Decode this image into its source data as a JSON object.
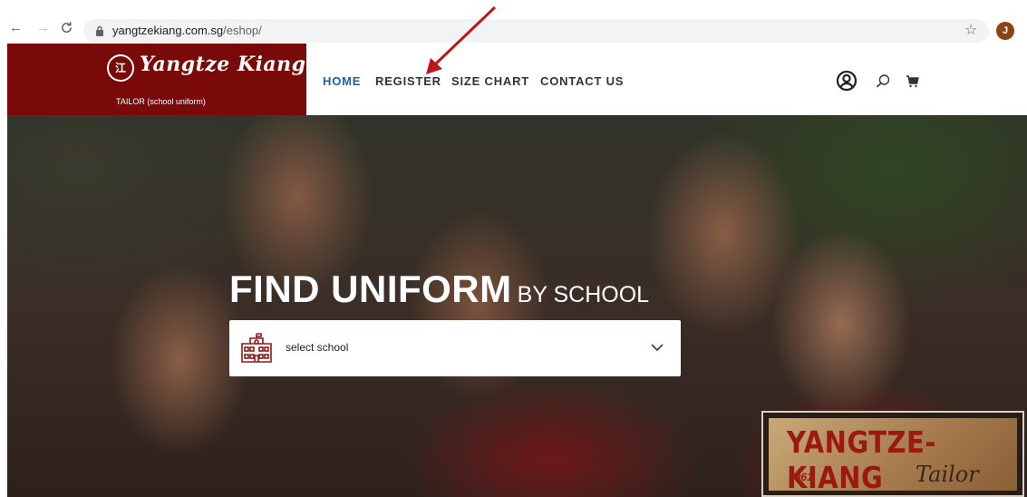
{
  "browser": {
    "url_host": "yangtzekiang.com.sg",
    "url_path": "/eshop/",
    "profile_initial": "J",
    "icons": [
      "back-icon",
      "forward-icon",
      "reload-icon",
      "lock-icon",
      "star-icon"
    ]
  },
  "header": {
    "logo_text": "Yangtze Kiang",
    "logo_emblem": "江",
    "logo_subtitle": "TAILOR (school uniform)",
    "menu": [
      {
        "label": "HOME",
        "active": true
      },
      {
        "label": "REGISTER",
        "active": false
      },
      {
        "label": "SIZE CHART",
        "active": false
      },
      {
        "label": "CONTACT US",
        "active": false
      }
    ],
    "icons": [
      "account-icon",
      "search-icon",
      "cart-icon"
    ]
  },
  "hero": {
    "title_big": "FIND UNIFORM",
    "title_small": "BY SCHOOL",
    "select_placeholder": "select school",
    "badge_title": "YANGTZE-KIANG",
    "badge_year": "1961",
    "badge_subtitle": "Tailor"
  },
  "colors": {
    "brand_red": "#7a0a0a",
    "active_menu": "#1e5fa8",
    "annotation_arrow": "#c0141c"
  }
}
